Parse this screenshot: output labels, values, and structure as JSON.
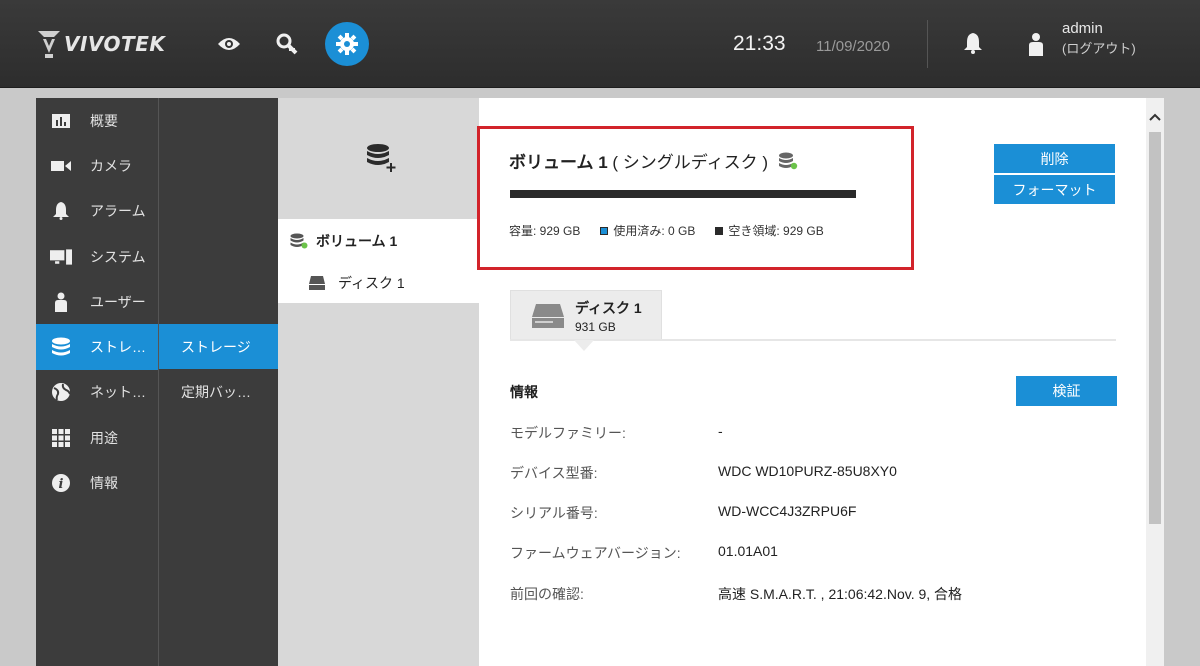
{
  "header": {
    "logo_text": "VIVOTEK",
    "time": "21:33",
    "date": "11/09/2020",
    "user": "admin",
    "logout": "(ログアウト)",
    "nav_icons": [
      "eye-icon",
      "search-key-icon",
      "gear-icon"
    ],
    "active_nav": "gear-icon"
  },
  "sidebar": {
    "items": [
      {
        "label": "概要",
        "icon": "chart-icon"
      },
      {
        "label": "カメラ",
        "icon": "camera-icon"
      },
      {
        "label": "アラーム",
        "icon": "bell-icon"
      },
      {
        "label": "システム",
        "icon": "system-icon"
      },
      {
        "label": "ユーザー",
        "icon": "user-icon"
      },
      {
        "label": "ストレ…",
        "icon": "storage-icon",
        "active": true
      },
      {
        "label": "ネット…",
        "icon": "network-icon"
      },
      {
        "label": "用途",
        "icon": "grid-icon"
      },
      {
        "label": "情報",
        "icon": "info-icon"
      }
    ]
  },
  "subnav": {
    "items": [
      {
        "label": "ストレージ",
        "active": true
      },
      {
        "label": "定期バッ…"
      }
    ]
  },
  "tree": {
    "volume": "ボリューム 1",
    "disk": "ディスク 1"
  },
  "volume": {
    "title_bold": "ボリューム 1",
    "title_rest": "( シングルディスク )",
    "capacity": "容量: 929 GB",
    "used": "使用済み: 0 GB",
    "free": "空き領域: 929 GB",
    "used_fraction": 0
  },
  "actions": {
    "delete": "削除",
    "format": "フォーマット",
    "verify": "検証"
  },
  "disk_tab": {
    "name": "ディスク 1",
    "size": "931 GB"
  },
  "info": {
    "heading": "情報",
    "rows": [
      {
        "label": "モデルファミリー:",
        "value": "-"
      },
      {
        "label": "デバイス型番:",
        "value": "WDC WD10PURZ-85U8XY0"
      },
      {
        "label": "シリアル番号:",
        "value": "WD-WCC4J3ZRPU6F"
      },
      {
        "label": "ファームウェアバージョン:",
        "value": "01.01A01"
      },
      {
        "label": "前回の確認:",
        "value": "高速 S.M.A.R.T. , 21:06:42.Nov. 9, 合格"
      }
    ]
  },
  "colors": {
    "accent": "#1b8fd6",
    "highlight": "#d2232a",
    "sidebar": "#3c3c3c"
  }
}
